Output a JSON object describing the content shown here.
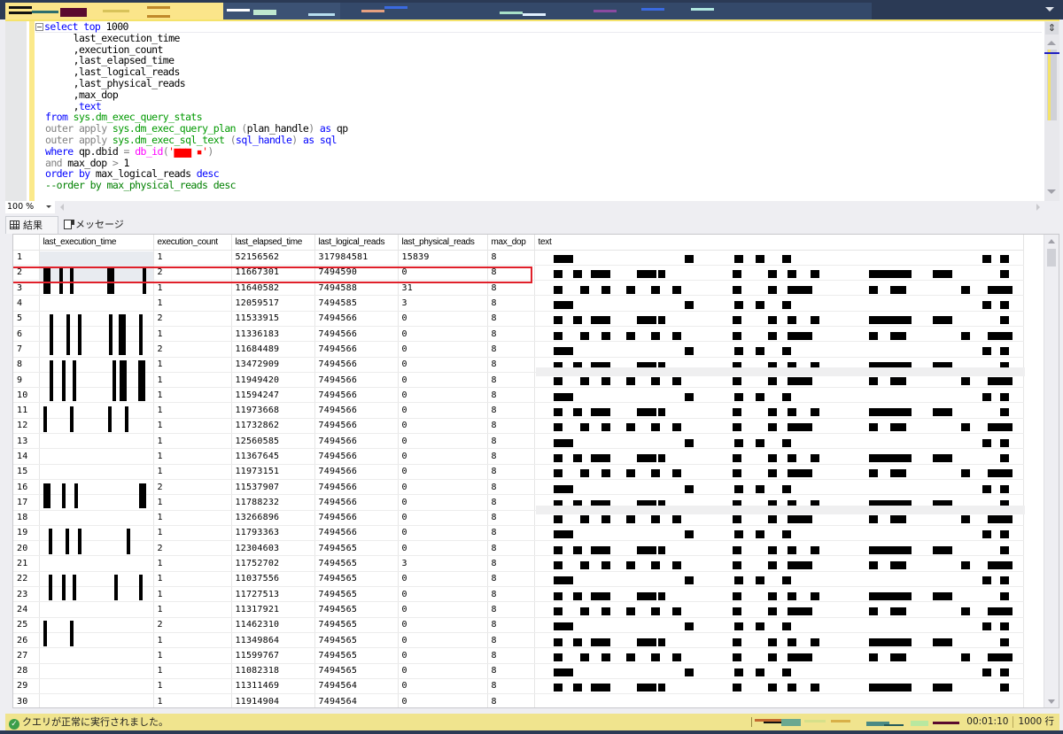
{
  "editor": {
    "lines": [
      {
        "parts": [
          {
            "t": "select",
            "c": "kw"
          },
          {
            "t": " "
          },
          {
            "t": "top",
            "c": "kw"
          },
          {
            "t": " 1000"
          }
        ],
        "collapsible": true
      },
      {
        "parts": [
          {
            "t": "     last_execution_time"
          }
        ]
      },
      {
        "parts": [
          {
            "t": "     ,execution_count"
          }
        ]
      },
      {
        "parts": [
          {
            "t": "     ,last_elapsed_time"
          }
        ]
      },
      {
        "parts": [
          {
            "t": "     ,last_logical_reads"
          }
        ]
      },
      {
        "parts": [
          {
            "t": "     ,last_physical_reads"
          }
        ]
      },
      {
        "parts": [
          {
            "t": "     ,max_dop"
          }
        ]
      },
      {
        "parts": [
          {
            "t": "     ,"
          },
          {
            "t": "text",
            "c": "kw"
          }
        ]
      },
      {
        "parts": [
          {
            "t": "from",
            "c": "kw"
          },
          {
            "t": " "
          },
          {
            "t": "sys.dm_exec_query_stats",
            "c": "sys"
          }
        ]
      },
      {
        "parts": [
          {
            "t": "outer apply",
            "c": "gray"
          },
          {
            "t": " "
          },
          {
            "t": "sys.dm_exec_query_plan",
            "c": "sys"
          },
          {
            "t": " "
          },
          {
            "t": "(",
            "c": "gray"
          },
          {
            "t": "plan_handle"
          },
          {
            "t": ")",
            "c": "gray"
          },
          {
            "t": " "
          },
          {
            "t": "as",
            "c": "kw"
          },
          {
            "t": " qp"
          }
        ]
      },
      {
        "parts": [
          {
            "t": "outer apply",
            "c": "gray"
          },
          {
            "t": " "
          },
          {
            "t": "sys.dm_exec_sql_text",
            "c": "sys"
          },
          {
            "t": " "
          },
          {
            "t": "(",
            "c": "gray"
          },
          {
            "t": "sql_handle",
            "c": "kw"
          },
          {
            "t": ")",
            "c": "gray"
          },
          {
            "t": " "
          },
          {
            "t": "as",
            "c": "kw"
          },
          {
            "t": " "
          },
          {
            "t": "sql",
            "c": "kw"
          }
        ]
      },
      {
        "parts": [
          {
            "t": "where",
            "c": "kw"
          },
          {
            "t": " qp.dbid "
          },
          {
            "t": "=",
            "c": "gray"
          },
          {
            "t": " "
          },
          {
            "t": "db_id",
            "c": "pink"
          },
          {
            "t": "(",
            "c": "gray"
          },
          {
            "t": "'▆▆▆ ▪'",
            "c": "red"
          },
          {
            "t": ")",
            "c": "gray"
          }
        ]
      },
      {
        "parts": [
          {
            "t": "and",
            "c": "gray"
          },
          {
            "t": " max_dop "
          },
          {
            "t": ">",
            "c": "gray"
          },
          {
            "t": " 1"
          }
        ]
      },
      {
        "parts": [
          {
            "t": "order by",
            "c": "kw"
          },
          {
            "t": " max_logical_reads "
          },
          {
            "t": "desc",
            "c": "kw"
          }
        ]
      },
      {
        "parts": [
          {
            "t": "--order by max_physical_reads desc",
            "c": "cmt"
          }
        ]
      }
    ]
  },
  "zoom": {
    "level": "100 %"
  },
  "tabs": {
    "results": "結果",
    "messages": "メッセージ"
  },
  "grid": {
    "columns": [
      "",
      "last_execution_time",
      "execution_count",
      "last_elapsed_time",
      "last_logical_reads",
      "last_physical_reads",
      "max_dop",
      "text"
    ],
    "selected_row": 2,
    "rows": [
      {
        "n": "1",
        "ec": "1",
        "elt": "52156562",
        "lr": "317984581",
        "pr": "15839",
        "dop": "8"
      },
      {
        "n": "2",
        "ec": "2",
        "elt": "11667301",
        "lr": "7494590",
        "pr": "0",
        "dop": "8"
      },
      {
        "n": "3",
        "ec": "1",
        "elt": "11640582",
        "lr": "7494588",
        "pr": "31",
        "dop": "8"
      },
      {
        "n": "4",
        "ec": "1",
        "elt": "12059517",
        "lr": "7494585",
        "pr": "3",
        "dop": "8"
      },
      {
        "n": "5",
        "ec": "2",
        "elt": "11533915",
        "lr": "7494566",
        "pr": "0",
        "dop": "8"
      },
      {
        "n": "6",
        "ec": "1",
        "elt": "11336183",
        "lr": "7494566",
        "pr": "0",
        "dop": "8"
      },
      {
        "n": "7",
        "ec": "2",
        "elt": "11684489",
        "lr": "7494566",
        "pr": "0",
        "dop": "8"
      },
      {
        "n": "8",
        "ec": "1",
        "elt": "13472909",
        "lr": "7494566",
        "pr": "0",
        "dop": "8"
      },
      {
        "n": "9",
        "ec": "1",
        "elt": "11949420",
        "lr": "7494566",
        "pr": "0",
        "dop": "8"
      },
      {
        "n": "10",
        "ec": "1",
        "elt": "11594247",
        "lr": "7494566",
        "pr": "0",
        "dop": "8"
      },
      {
        "n": "11",
        "ec": "1",
        "elt": "11973668",
        "lr": "7494566",
        "pr": "0",
        "dop": "8"
      },
      {
        "n": "12",
        "ec": "1",
        "elt": "11732862",
        "lr": "7494566",
        "pr": "0",
        "dop": "8"
      },
      {
        "n": "13",
        "ec": "1",
        "elt": "12560585",
        "lr": "7494566",
        "pr": "0",
        "dop": "8"
      },
      {
        "n": "14",
        "ec": "1",
        "elt": "11367645",
        "lr": "7494566",
        "pr": "0",
        "dop": "8"
      },
      {
        "n": "15",
        "ec": "1",
        "elt": "11973151",
        "lr": "7494566",
        "pr": "0",
        "dop": "8"
      },
      {
        "n": "16",
        "ec": "2",
        "elt": "11537907",
        "lr": "7494566",
        "pr": "0",
        "dop": "8"
      },
      {
        "n": "17",
        "ec": "1",
        "elt": "11788232",
        "lr": "7494566",
        "pr": "0",
        "dop": "8"
      },
      {
        "n": "18",
        "ec": "1",
        "elt": "13266896",
        "lr": "7494566",
        "pr": "0",
        "dop": "8"
      },
      {
        "n": "19",
        "ec": "1",
        "elt": "11793363",
        "lr": "7494566",
        "pr": "0",
        "dop": "8"
      },
      {
        "n": "20",
        "ec": "2",
        "elt": "12304603",
        "lr": "7494565",
        "pr": "0",
        "dop": "8"
      },
      {
        "n": "21",
        "ec": "1",
        "elt": "11752702",
        "lr": "7494565",
        "pr": "3",
        "dop": "8"
      },
      {
        "n": "22",
        "ec": "1",
        "elt": "11037556",
        "lr": "7494565",
        "pr": "0",
        "dop": "8"
      },
      {
        "n": "23",
        "ec": "1",
        "elt": "11727513",
        "lr": "7494565",
        "pr": "0",
        "dop": "8"
      },
      {
        "n": "24",
        "ec": "1",
        "elt": "11317921",
        "lr": "7494565",
        "pr": "0",
        "dop": "8"
      },
      {
        "n": "25",
        "ec": "2",
        "elt": "11462310",
        "lr": "7494565",
        "pr": "0",
        "dop": "8"
      },
      {
        "n": "26",
        "ec": "1",
        "elt": "11349864",
        "lr": "7494565",
        "pr": "0",
        "dop": "8"
      },
      {
        "n": "27",
        "ec": "1",
        "elt": "11599767",
        "lr": "7494565",
        "pr": "0",
        "dop": "8"
      },
      {
        "n": "28",
        "ec": "1",
        "elt": "11082318",
        "lr": "7494565",
        "pr": "0",
        "dop": "8"
      },
      {
        "n": "29",
        "ec": "1",
        "elt": "11311469",
        "lr": "7494564",
        "pr": "0",
        "dop": "8"
      },
      {
        "n": "30",
        "ec": "1",
        "elt": "11914904",
        "lr": "7494564",
        "pr": "0",
        "dop": "8"
      }
    ]
  },
  "status": {
    "message": "クエリが正常に実行されました。",
    "elapsed": "00:01:10",
    "rows": "1000 行"
  },
  "colors": {
    "status_bar": "#f0e48e",
    "selection_box": "#e0202a",
    "success": "#3c9e4a",
    "frame": "#2b3a55"
  }
}
